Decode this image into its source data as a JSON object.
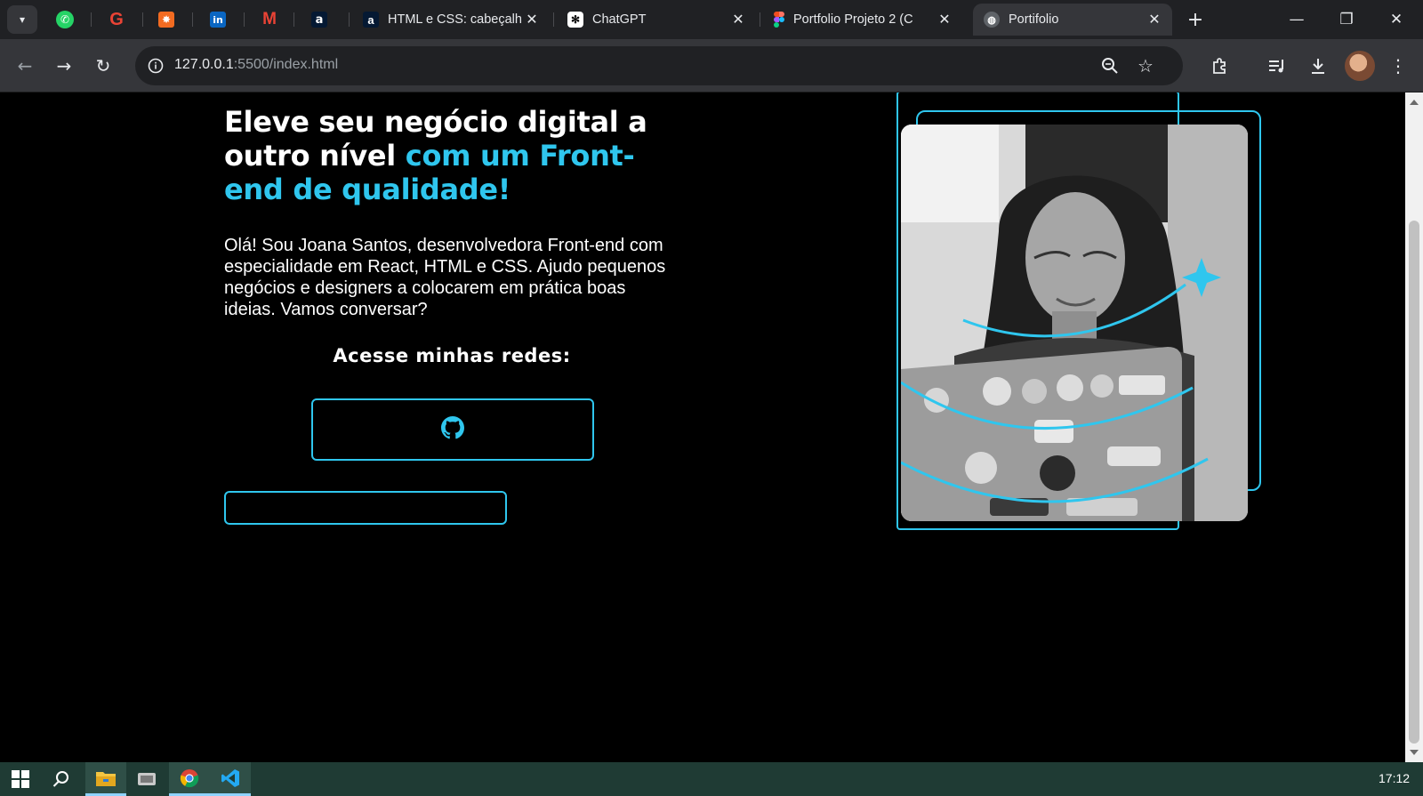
{
  "browser": {
    "pinned_tabs": [
      {
        "name": "whatsapp"
      },
      {
        "name": "google"
      },
      {
        "name": "phoenix"
      },
      {
        "name": "linkedin"
      },
      {
        "name": "gmail"
      },
      {
        "name": "alura"
      }
    ],
    "tabs": [
      {
        "title": "HTML e CSS: cabeçalh",
        "favicon": "alura",
        "active": false
      },
      {
        "title": "ChatGPT",
        "favicon": "chatgpt",
        "active": false
      },
      {
        "title": "Portfolio Projeto 2 (C",
        "favicon": "figma",
        "active": false
      },
      {
        "title": "Portifolio",
        "favicon": "globe",
        "active": true
      }
    ],
    "address_host": "127.0.0.1",
    "address_path": ":5500/index.html"
  },
  "page": {
    "heading_white": "Eleve seu negócio digital a outro nível ",
    "heading_accent": "com um Front-end de qualidade!",
    "intro": "Olá! Sou Joana Santos, desenvolvedora Front-end com especialidade em React, HTML e CSS. Ajudo pequenos negócios e designers a colocarem em prática boas ideias. Vamos conversar?",
    "networks_label": "Acesse minhas redes:",
    "accent_color": "#2fc6ee",
    "github_icon": "github-icon",
    "photo_alt": "Joana Santos"
  },
  "taskbar": {
    "clock": "17:12"
  }
}
